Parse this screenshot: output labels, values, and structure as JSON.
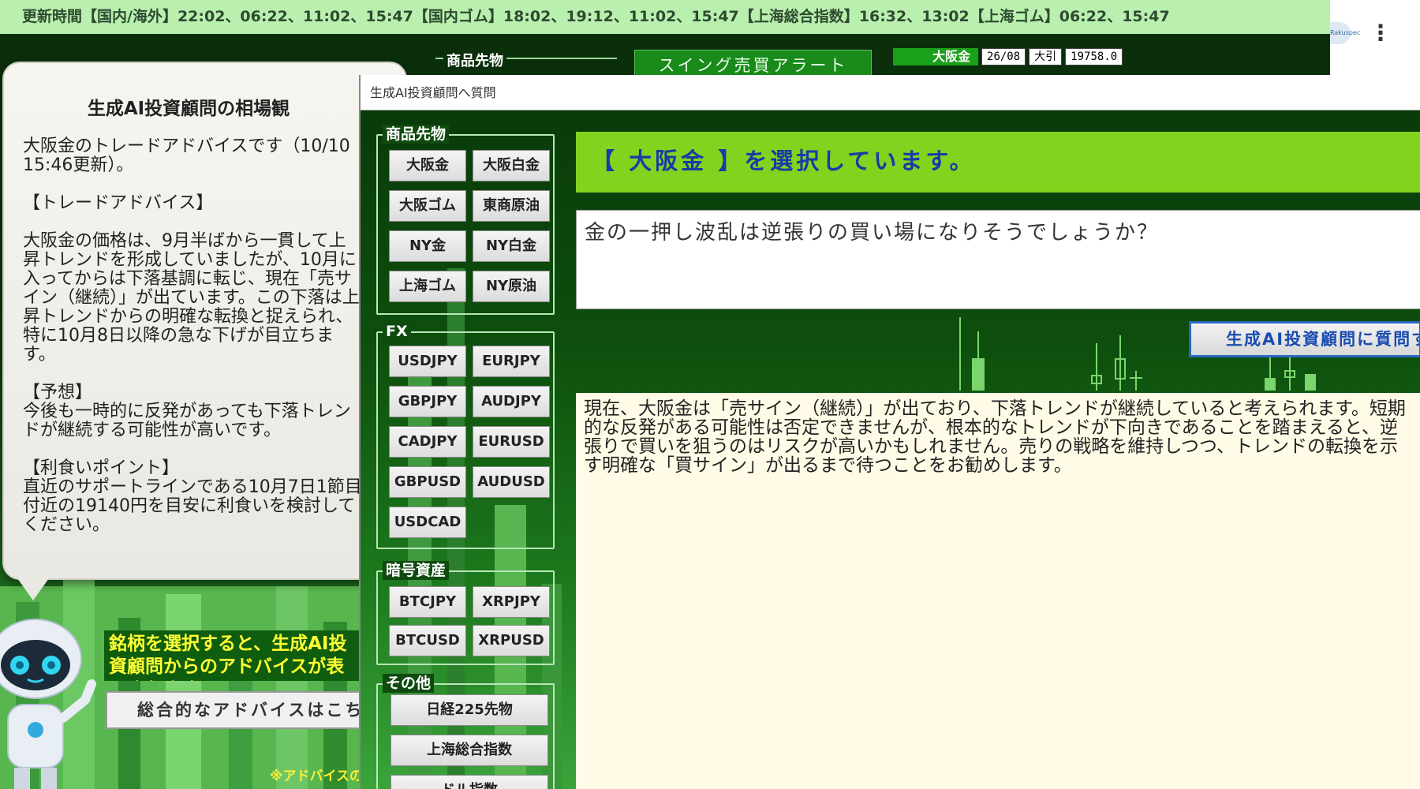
{
  "ticker": {
    "text": "更新時間【国内/海外】22:02、06:22、11:02、15:47【国内ゴム】18:02、19:12、11:02、15:47【上海総合指数】16:32、13:02【上海ゴム】06:22、15:47"
  },
  "browser": {
    "logo_text": "Rakuspec",
    "menu_glyph": "⋮"
  },
  "background": {
    "group_label": "商品先物",
    "swing_alert": "スイング売買アラート",
    "mini_ticker": {
      "name": "大阪金",
      "date": "26/08",
      "session": "大引",
      "price": "19758.0"
    }
  },
  "advice": {
    "title": "生成AI投資顧問の相場観",
    "text": "大阪金のトレードアドバイスです（10/10 15:46更新）。\n\n【トレードアドバイス】\n\n大阪金の価格は、9月半ばから一貫して上昇トレンドを形成していましたが、10月に入ってからは下落基調に転じ、現在「売サイン（継続）」が出ています。この下落は上昇トレンドからの明確な転換と捉えられ、特に10月8日以降の急な下げが目立ちます。\n\n【予想】\n今後も一時的に反発があっても下落トレンドが継続する可能性が高いです。\n\n【利食いポイント】\n直近のサポートラインである10月7日1節目付近の19140円を目安に利食いを検討してください。",
    "select_hint": "銘柄を選択すると、生成AI投資顧問からのアドバイスが表示されます。",
    "overall_button": "総合的なアドバイスはこちら",
    "disclaimer": "※アドバイスの"
  },
  "modal": {
    "title": "生成AI投資顧問へ質問",
    "groups": {
      "commodities": {
        "label": "商品先物",
        "buttons": [
          "大阪金",
          "大阪白金",
          "大阪ゴム",
          "東商原油",
          "NY金",
          "NY白金",
          "上海ゴム",
          "NY原油"
        ]
      },
      "fx": {
        "label": "FX",
        "buttons": [
          "USDJPY",
          "EURJPY",
          "GBPJPY",
          "AUDJPY",
          "CADJPY",
          "EURUSD",
          "GBPUSD",
          "AUDUSD",
          "USDCAD"
        ]
      },
      "crypto": {
        "label": "暗号資産",
        "buttons": [
          "BTCJPY",
          "XRPJPY",
          "BTCUSD",
          "XRPUSD"
        ]
      },
      "other": {
        "label": "その他",
        "buttons": [
          "日経225先物",
          "上海総合指数",
          "ドル指数"
        ]
      }
    },
    "selected_banner": "【 大阪金 】を選択しています。",
    "question": "金の一押し波乱は逆張りの買い場になりそうでしょうか？",
    "ask_button": "生成AI投資顧問に質問する",
    "answer": "現在、大阪金は「売サイン（継続）」が出ており、下落トレンドが継続していると考えられます。短期的な反発がある可能性は否定できませんが、根本的なトレンドが下向きであることを踏まえると、逆張りで買いを狙うのはリスクが高いかもしれません。売りの戦略を維持しつつ、トレンドの転換を示す明確な「買サイン」が出るまで待つことをお勧めします。"
  },
  "colors": {
    "ticker_bg": "#b9f0b0",
    "banner_bg": "#83d31e",
    "banner_text": "#1a3aa6",
    "hint_text": "#ffff33",
    "answer_bg": "#fffbe6"
  }
}
